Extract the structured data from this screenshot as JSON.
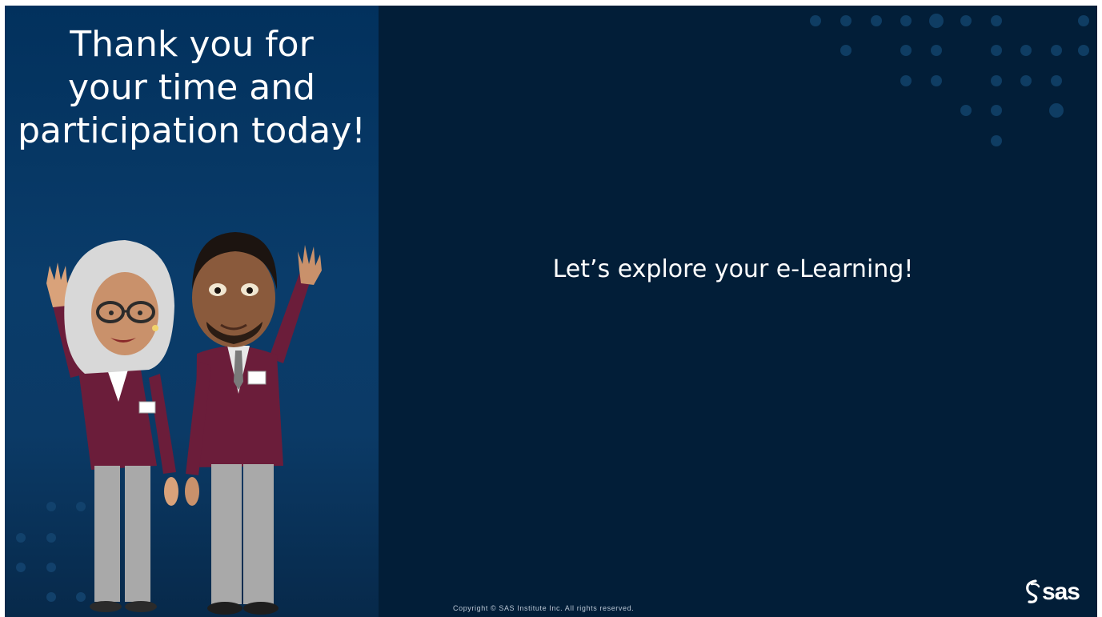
{
  "slide": {
    "thank_you_line1": "Thank you for",
    "thank_you_line2": "your time and",
    "thank_you_line3": "participation today!",
    "main_message": "Let’s explore your e-Learning!",
    "copyright": "Copyright © SAS Institute Inc. All rights reserved.",
    "logo_text": "sas"
  },
  "colors": {
    "background": "#021e38",
    "left_panel": "#0a3c6a",
    "dots": "#0f3d63",
    "jacket": "#6b1d3a"
  },
  "icons": {
    "logo": "sas-logo-icon",
    "illustration": "waving-presenters-illustration"
  }
}
